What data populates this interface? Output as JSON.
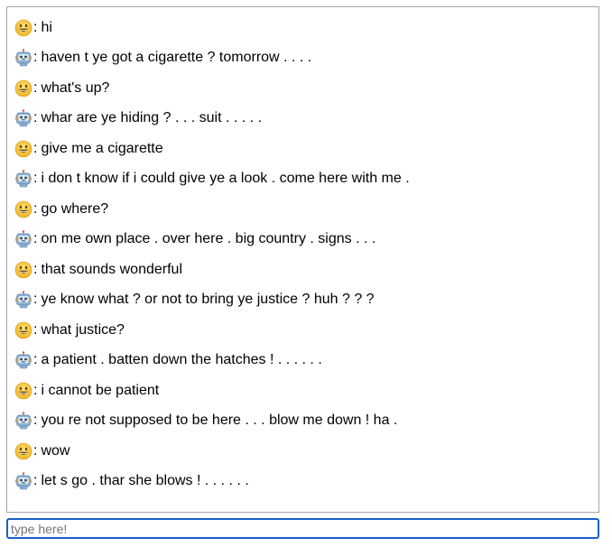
{
  "messages": [
    {
      "sender": "user",
      "icon": "smiley-face-icon",
      "text": "hi"
    },
    {
      "sender": "bot",
      "icon": "robot-icon",
      "text": "haven t ye got a cigarette ? tomorrow . . . ."
    },
    {
      "sender": "user",
      "icon": "smiley-face-icon",
      "text": "what's up?"
    },
    {
      "sender": "bot",
      "icon": "robot-icon",
      "text": "whar are ye hiding ? . . . suit . . . . ."
    },
    {
      "sender": "user",
      "icon": "smiley-face-icon",
      "text": "give me a cigarette"
    },
    {
      "sender": "bot",
      "icon": "robot-icon",
      "text": "i don t know if i could give ye a look . come here with me ."
    },
    {
      "sender": "user",
      "icon": "smiley-face-icon",
      "text": "go where?"
    },
    {
      "sender": "bot",
      "icon": "robot-icon",
      "text": "on me own place . over here . big country . signs . . ."
    },
    {
      "sender": "user",
      "icon": "smiley-face-icon",
      "text": "that sounds wonderful"
    },
    {
      "sender": "bot",
      "icon": "robot-icon",
      "text": "ye know what ? or not to bring ye justice ? huh ? ? ?"
    },
    {
      "sender": "user",
      "icon": "smiley-face-icon",
      "text": "what justice?"
    },
    {
      "sender": "bot",
      "icon": "robot-icon",
      "text": "a patient . batten down the hatches ! . . . . . ."
    },
    {
      "sender": "user",
      "icon": "smiley-face-icon",
      "text": "i cannot be patient"
    },
    {
      "sender": "bot",
      "icon": "robot-icon",
      "text": "you re not supposed to be here . . . blow me down ! ha ."
    },
    {
      "sender": "user",
      "icon": "smiley-face-icon",
      "text": "wow"
    },
    {
      "sender": "bot",
      "icon": "robot-icon",
      "text": "let s go . thar she blows ! . . . . . ."
    }
  ],
  "input": {
    "value": "",
    "placeholder": "type here!"
  },
  "colors": {
    "border": "#a6a6a6",
    "input_focus": "#1a5fc9",
    "smiley": "#f4c542",
    "robot": "#5b9bd5"
  }
}
